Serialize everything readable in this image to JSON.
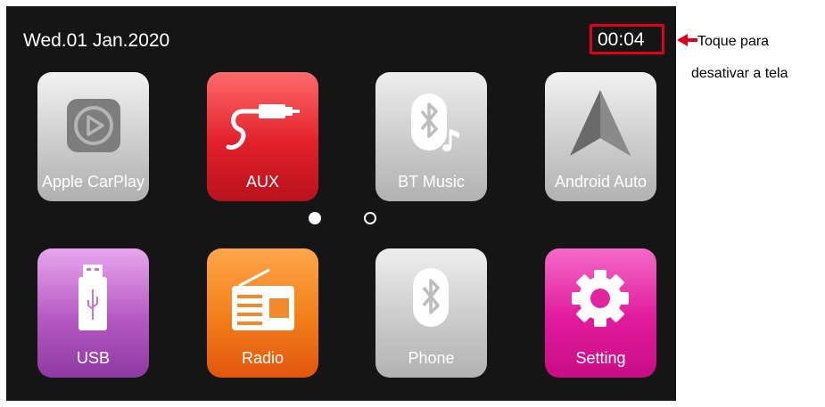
{
  "status_bar": {
    "date": "Wed.01 Jan.2020",
    "time": "00:04"
  },
  "annotation": {
    "line1": "Toque para",
    "line2": "desativar a tela",
    "color": "#e0001b"
  },
  "apps": {
    "carplay": {
      "label": "Apple CarPlay",
      "icon": "carplay-icon"
    },
    "aux": {
      "label": "AUX",
      "icon": "aux-cable-icon"
    },
    "bt_music": {
      "label": "BT Music",
      "icon": "bluetooth-music-icon"
    },
    "android_auto": {
      "label": "Android Auto",
      "icon": "android-auto-icon"
    },
    "usb": {
      "label": "USB",
      "icon": "usb-icon"
    },
    "radio": {
      "label": "Radio",
      "icon": "radio-icon"
    },
    "phone": {
      "label": "Phone",
      "icon": "bluetooth-phone-icon"
    },
    "setting": {
      "label": "Setting",
      "icon": "gear-icon"
    }
  },
  "pagination": {
    "current_page": 1,
    "total_pages": 2
  }
}
